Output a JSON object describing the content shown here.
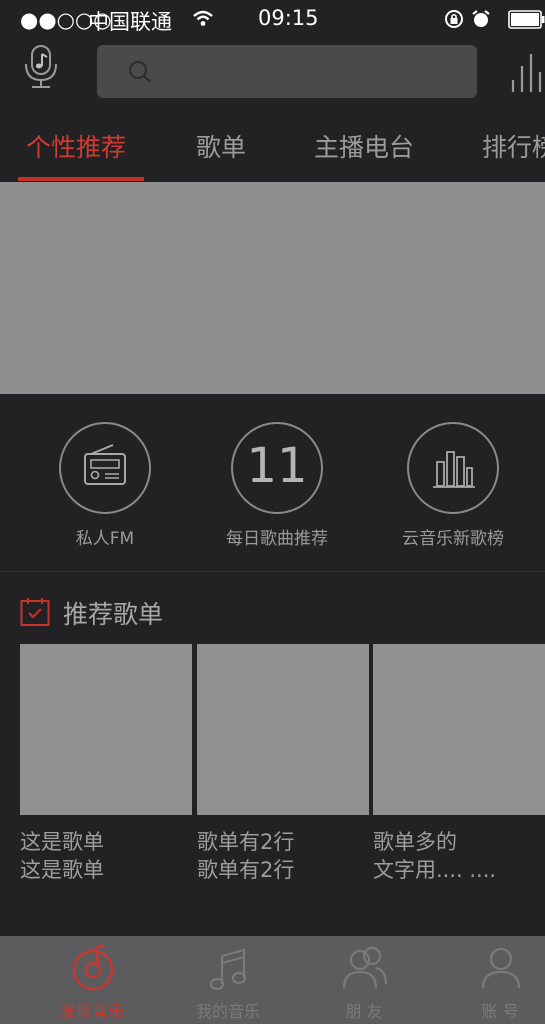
{
  "status_bar": {
    "signal": "●●○○○",
    "carrier": "中国联通",
    "time": "09:15"
  },
  "search": {
    "placeholder": ""
  },
  "tabs": [
    {
      "label": "个性推荐",
      "active": true
    },
    {
      "label": "歌单"
    },
    {
      "label": "主播电台"
    },
    {
      "label": "排行榜"
    }
  ],
  "features": [
    {
      "label": "私人FM",
      "icon": "radio-icon"
    },
    {
      "label": "每日歌曲推荐",
      "icon": "calendar-day-icon",
      "number": "11"
    },
    {
      "label": "云音乐新歌榜",
      "icon": "chart-bars-icon"
    }
  ],
  "section": {
    "title": "推荐歌单"
  },
  "playlists": [
    {
      "title": "这是歌单\n这是歌单"
    },
    {
      "title": "歌单有2行\n歌单有2行"
    },
    {
      "title": "歌单多的\n文字用.... ...."
    }
  ],
  "bottom_nav": [
    {
      "label": "发现音乐",
      "icon": "netease-music-icon",
      "active": true
    },
    {
      "label": "我的音乐",
      "icon": "music-note-icon"
    },
    {
      "label": "朋 友",
      "icon": "friends-icon"
    },
    {
      "label": "账 号",
      "icon": "account-icon"
    }
  ],
  "colors": {
    "accent": "#d33a31",
    "background": "#222224",
    "banner": "#8f8f8f",
    "nav_bar": "#5c5c5e"
  }
}
